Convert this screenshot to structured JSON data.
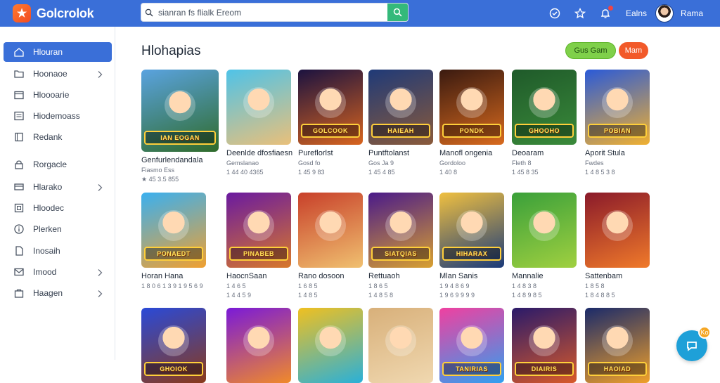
{
  "header": {
    "app_name": "Golcrolok",
    "search_placeholder": "sianran fs flialk Ereom",
    "link_label": "Ealns",
    "user_name": "Rama"
  },
  "sidebar": {
    "items": [
      {
        "label": "Hlouran",
        "icon": "home-icon",
        "active": true,
        "chevron": false
      },
      {
        "label": "Hoonaoe",
        "icon": "folder-icon",
        "active": false,
        "chevron": true
      },
      {
        "label": "Hloooarie",
        "icon": "calendar-icon",
        "active": false,
        "chevron": false
      },
      {
        "label": "Hiodemoass",
        "icon": "list-icon",
        "active": false,
        "chevron": false
      },
      {
        "label": "Redank",
        "icon": "book-icon",
        "active": false,
        "chevron": false
      },
      {
        "label": "Rorgacle",
        "icon": "lock-icon",
        "active": false,
        "chevron": false
      },
      {
        "label": "Hlarako",
        "icon": "card-icon",
        "active": false,
        "chevron": true
      },
      {
        "label": "Hloodec",
        "icon": "square-icon",
        "active": false,
        "chevron": false
      },
      {
        "label": "Plerken",
        "icon": "info-icon",
        "active": false,
        "chevron": false
      },
      {
        "label": "Inosaih",
        "icon": "file-icon",
        "active": false,
        "chevron": false
      },
      {
        "label": "Imood",
        "icon": "mail-icon",
        "active": false,
        "chevron": true
      },
      {
        "label": "Haagen",
        "icon": "bag-icon",
        "active": false,
        "chevron": true
      }
    ]
  },
  "main": {
    "title": "Hlohapias",
    "green_button": "Gus Gam",
    "orange_button": "Mam",
    "cards_row1": [
      {
        "name": "Genfurlendandala",
        "meta": "Fiasmo Ess",
        "rating": "★ 45 3.5 855",
        "banner": "IAN EOGAN",
        "bg1": "#5aa3e0",
        "bg2": "#2f6b2a"
      },
      {
        "name": "Deenlde dfosfiaesn",
        "meta": "Gemslanao",
        "rating": "1 44 40 4365",
        "banner": "",
        "bg1": "#4fc3e8",
        "bg2": "#e9c07a"
      },
      {
        "name": "Pureflorlst",
        "meta": "Gosd fo",
        "rating": "1 45 9 83",
        "banner": "GOLCOOK",
        "bg1": "#1b1240",
        "bg2": "#d8641e"
      },
      {
        "name": "Puntftolanst",
        "meta": "Gos Ja 9",
        "rating": "1 45 4 85",
        "banner": "HAIEAH",
        "bg1": "#1f3a78",
        "bg2": "#8a5a3a"
      },
      {
        "name": "Manofl ongenia",
        "meta": "Gordoloo",
        "rating": "1 40 8",
        "banner": "PONDK",
        "bg1": "#3a1a10",
        "bg2": "#d86a1e"
      },
      {
        "name": "Deoaram",
        "meta": "Fleth 8",
        "rating": "1 45 8 35",
        "banner": "GHOOHO",
        "bg1": "#1f5a2a",
        "bg2": "#3a8a3a"
      },
      {
        "name": "Aporit Stula",
        "meta": "Fwdes",
        "rating": "1 4 8 5 3 8",
        "banner": "POBIAN",
        "bg1": "#2a5ad8",
        "bg2": "#f0b030"
      }
    ],
    "cards_row2": [
      {
        "name": "Horan Hana",
        "meta": "",
        "rating": "1 8 0 6 1 3 9 1 9 5 6 9",
        "banner": "PONAEDT",
        "bg1": "#3ab0f0",
        "bg2": "#f0a030"
      },
      {
        "name": "HaocnSaan",
        "meta": "1 4 6 5",
        "rating": "1 4 4 5 9",
        "banner": "PINABEB",
        "bg1": "#6a1aa0",
        "bg2": "#d8782a"
      },
      {
        "name": "Rano dosoon",
        "meta": "1 6 8 5",
        "rating": "1 4 8 5",
        "banner": "",
        "bg1": "#c8402a",
        "bg2": "#f0c070"
      },
      {
        "name": "Rettuaoh",
        "meta": "1 8 6 5",
        "rating": "1 4 8 5 8",
        "banner": "SIATQIAS",
        "bg1": "#4a1a8a",
        "bg2": "#d8a030"
      },
      {
        "name": "Mlan Sanis",
        "meta": "1 9 4 8 6 9",
        "rating": "1 9 6 9 9 9 9",
        "banner": "HIHARAX",
        "bg1": "#f0c040",
        "bg2": "#1a3a7a"
      },
      {
        "name": "Mannalie",
        "meta": "1 4 8 3 8",
        "rating": "1 4 8 9 8 5",
        "banner": "",
        "bg1": "#3aa03a",
        "bg2": "#a0d040"
      },
      {
        "name": "Sattenbam",
        "meta": "1 8 5 8",
        "rating": "1 8 4 8 8 5",
        "banner": "",
        "bg1": "#8a1a2a",
        "bg2": "#f07a2a"
      }
    ],
    "cards_row3": [
      {
        "banner": "GHOIOK",
        "bg1": "#2a4ad8",
        "bg2": "#8a3a1a"
      },
      {
        "banner": "",
        "bg1": "#7a1ad8",
        "bg2": "#f08a2a"
      },
      {
        "banner": "",
        "bg1": "#f0c020",
        "bg2": "#2ab0d8"
      },
      {
        "banner": "",
        "bg1": "#d8b07a",
        "bg2": "#f0d8b0"
      },
      {
        "banner": "TANIRIAS",
        "bg1": "#f040a0",
        "bg2": "#30a0f0"
      },
      {
        "banner": "DIAIRIS",
        "bg1": "#2a1a6a",
        "bg2": "#d85a2a"
      },
      {
        "banner": "HAOIAD",
        "bg1": "#1a2a6a",
        "bg2": "#f0a02a"
      }
    ]
  },
  "fab": {
    "badge": "Ko"
  }
}
